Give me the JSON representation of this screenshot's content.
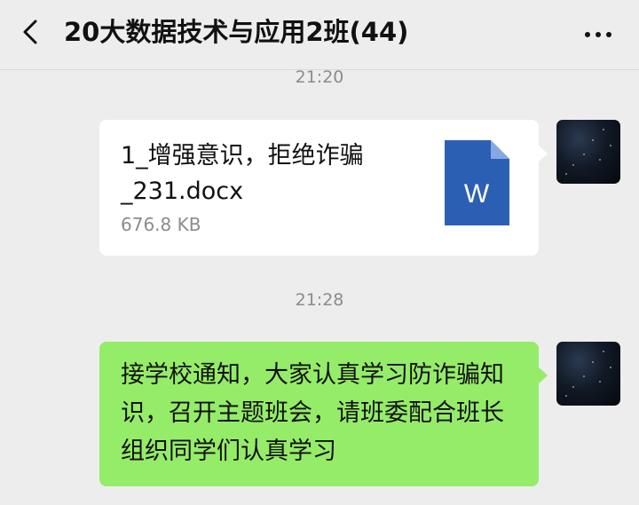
{
  "header": {
    "title": "20大数据技术与应用2班(44)",
    "back_icon": "chevron-left-icon",
    "more_icon": "more-dots-icon",
    "more_glyph": "···"
  },
  "messages": [
    {
      "timestamp": "21:20",
      "type": "file",
      "file_name": "1_增强意识，拒绝诈骗_231.docx",
      "file_size": "676.8 KB",
      "file_icon": "word-doc-icon",
      "file_icon_letter": "W",
      "file_icon_color": "#2b5fb4"
    },
    {
      "timestamp": "21:28",
      "type": "text",
      "text": "接学校通知，大家认真学习防诈骗知识，召开主题班会，请班委配合班长组织同学们认真学习",
      "bubble_color": "#95ec69"
    }
  ]
}
